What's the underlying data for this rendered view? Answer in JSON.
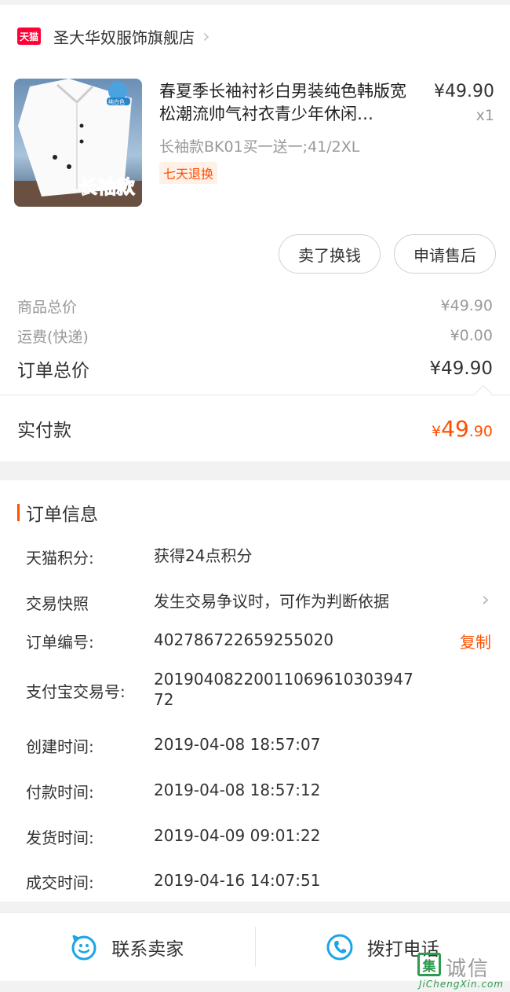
{
  "store": {
    "badge": "天猫",
    "name": "圣大华奴服饰旗舰店"
  },
  "product": {
    "title": "春夏季长袖衬衫白男装纯色韩版宽松潮流帅气衬衣青少年休闲…",
    "price": "¥49.90",
    "qty": "x1",
    "sku": "长袖款BK01买一送一;41/2XL",
    "tag": "七天退换",
    "image_caption": "长袖款"
  },
  "actions": {
    "sell_label": "卖了换钱",
    "after_sale_label": "申请售后"
  },
  "summary": {
    "goods_total_label": "商品总价",
    "goods_total_value": "¥49.90",
    "shipping_label": "运费(快递)",
    "shipping_value": "¥0.00",
    "order_total_label": "订单总价",
    "order_total_value": "¥49.90"
  },
  "paid": {
    "label": "实付款",
    "currency": "¥",
    "integer": "49",
    "decimal": ".90"
  },
  "order_info": {
    "title": "订单信息",
    "rows": [
      {
        "key": "天猫积分:",
        "value": "获得24点积分"
      },
      {
        "key": "交易快照",
        "value": "发生交易争议时，可作为判断依据"
      },
      {
        "key": "订单编号:",
        "value": "402786722659255020",
        "action": "复制"
      },
      {
        "key": "支付宝交易号:",
        "value": "20190408220011069610303947 72"
      },
      {
        "key": "创建时间:",
        "value": "2019-04-08 18:57:07"
      },
      {
        "key": "付款时间:",
        "value": "2019-04-08 18:57:12"
      },
      {
        "key": "发货时间:",
        "value": "2019-04-09 09:01:22"
      },
      {
        "key": "成交时间:",
        "value": "2019-04-16 14:07:51"
      }
    ]
  },
  "bottom_bar": {
    "contact_seller": "联系卖家",
    "call_phone": "拨打电话"
  },
  "watermark": {
    "text": "诚信",
    "logo": "集",
    "url": "JiChengXin.com"
  },
  "colors": {
    "accent": "#ff5000",
    "tmall_red": "#ff0036",
    "icon_blue": "#1ba4e8"
  }
}
